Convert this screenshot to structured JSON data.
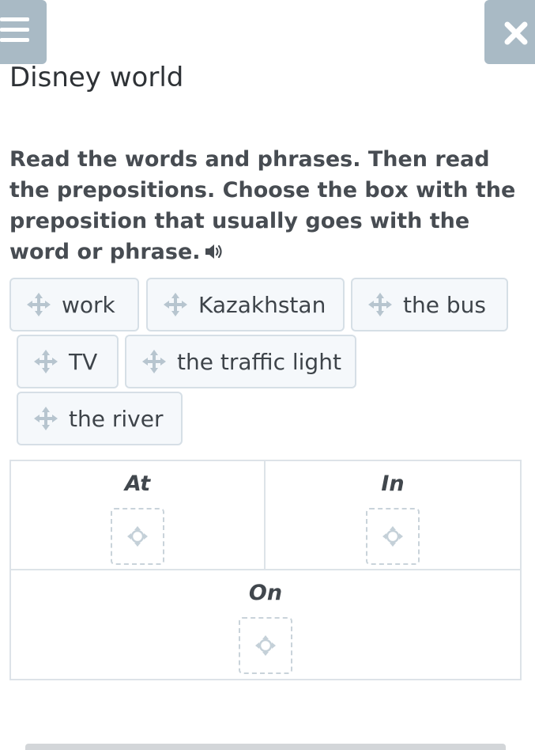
{
  "header": {
    "title": "Disney world",
    "menu_icon": "hamburger-menu-icon",
    "close_icon": "close-icon",
    "button_color": "#a9bac5"
  },
  "task": {
    "instructions": "Read the words and phrases. Then read the prepositions. Choose the box with the preposition that usually goes with the word or phrase.",
    "audio_icon": "speaker-icon"
  },
  "words": [
    {
      "label": "work"
    },
    {
      "label": "Kazakhstan"
    },
    {
      "label": "the bus"
    },
    {
      "label": "TV"
    },
    {
      "label": "the traffic light"
    },
    {
      "label": "the river"
    }
  ],
  "drop_zones": [
    {
      "label": "At"
    },
    {
      "label": "In"
    },
    {
      "label": "On"
    }
  ]
}
